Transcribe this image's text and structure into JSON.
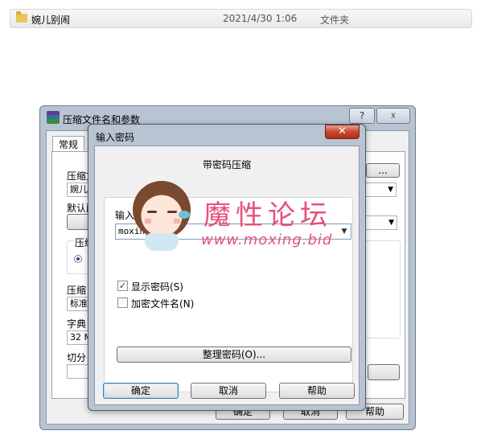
{
  "explorer": {
    "folder_name": "婉儿别闹",
    "date": "2021/4/30 1:06",
    "type": "文件夹"
  },
  "parent_dialog": {
    "title": "压缩文件名和参数",
    "help_btn": "?",
    "close_btn": "☓",
    "tab_general": "常规",
    "archive_label": "压缩文",
    "archive_value": "婉儿别",
    "browse_label": "...",
    "profile_label": "默认配",
    "format_label": "压缩",
    "method_label": "压缩",
    "method_value": "标准",
    "dict_label": "字典",
    "dict_value": "32 M",
    "split_label": "切分",
    "ok": "确定",
    "cancel": "取消",
    "help": "帮助"
  },
  "password_dialog": {
    "title": "输入密码",
    "close": "✕",
    "heading": "带密码压缩",
    "input_label": "输入",
    "password_value": "moxing",
    "show_password": "显示密码(S)",
    "show_password_checked": true,
    "encrypt_names": "加密文件名(N)",
    "encrypt_names_checked": false,
    "manage_button": "整理密码(O)...",
    "ok": "确定",
    "cancel": "取消",
    "help": "帮助"
  },
  "watermark": {
    "text": "魔性论坛",
    "url": "www.moxing.bid"
  }
}
